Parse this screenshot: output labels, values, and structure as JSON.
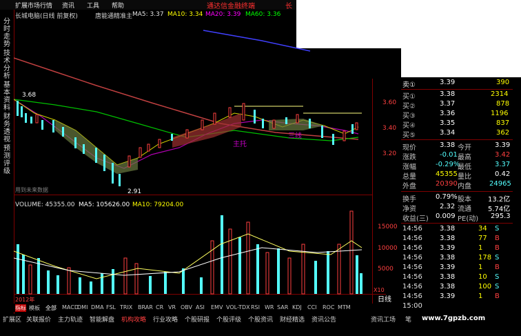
{
  "menubar": {
    "items": [
      "扩展市场行情",
      "资讯",
      "工具",
      "帮助"
    ]
  },
  "brand": "通达信金融终端",
  "brand_extra": "长",
  "sidebar": {
    "tabs": [
      "分时走势",
      "技术分析",
      "基本资料",
      "财务透视",
      "预测评级"
    ]
  },
  "title": {
    "stock": "长城电脑(日线 前复权)",
    "indicator": "唐能通精准主",
    "ma5_label": "MA5: 3.37",
    "ma10_label": "MA10: 3.34",
    "ma20_label": "MA20: 3.39",
    "ma60_label": "MA60: 3.36"
  },
  "chart": {
    "price_high_label": "3.68",
    "price_low_label": "2.91",
    "annotation1": "主托",
    "annotation2": "三线",
    "annotation3": "用到未来数据",
    "axis_prices": [
      "3.60",
      "3.40",
      "3.20"
    ],
    "axis_volumes": [
      "15000",
      "10000",
      "5000"
    ],
    "axis_unit": "X10",
    "year": "2012年"
  },
  "volume": {
    "vol": "VOLUME: 45355.00",
    "ma5": "MA5: 105626.00",
    "ma10": "MA10: 79204.00"
  },
  "quote": {
    "sell": [
      {
        "label": "卖①",
        "price": "3.39",
        "qty": "390"
      }
    ],
    "buy": [
      {
        "label": "买①",
        "price": "3.38",
        "qty": "2314"
      },
      {
        "label": "买②",
        "price": "3.37",
        "qty": "878"
      },
      {
        "label": "买③",
        "price": "3.36",
        "qty": "1196"
      },
      {
        "label": "买④",
        "price": "3.35",
        "qty": "837"
      },
      {
        "label": "买⑤",
        "price": "3.34",
        "qty": "362"
      }
    ],
    "stats": [
      {
        "l1": "现价",
        "v1": "3.38",
        "l2": "今开",
        "v2": "3.39"
      },
      {
        "l1": "涨跌",
        "v1": "-0.01",
        "l2": "最高",
        "v2": "3.42"
      },
      {
        "l1": "涨幅",
        "v1": "-0.29%",
        "l2": "最低",
        "v2": "3.37"
      },
      {
        "l1": "总量",
        "v1": "45355",
        "l2": "量比",
        "v2": "0.42"
      },
      {
        "l1": "外盘",
        "v1": "20390",
        "l2": "内盘",
        "v2": "24965"
      }
    ],
    "fin": [
      {
        "l1": "换手",
        "v1": "0.79%",
        "l2": "股本",
        "v2": "13.2亿"
      },
      {
        "l1": "净资",
        "v1": "2.32",
        "l2": "流通",
        "v2": "5.74亿"
      },
      {
        "l1": "收益(三)",
        "v1": "0.009",
        "l2": "PE(动)",
        "v2": "295.3"
      }
    ],
    "ticks": [
      {
        "time": "14:56",
        "price": "3.38",
        "vol": "34",
        "side": "S"
      },
      {
        "time": "14:56",
        "price": "3.38",
        "vol": "77",
        "side": "B"
      },
      {
        "time": "14:56",
        "price": "3.39",
        "vol": "1",
        "side": "B"
      },
      {
        "time": "14:56",
        "price": "3.38",
        "vol": "178",
        "side": "S"
      },
      {
        "time": "14:56",
        "price": "3.39",
        "vol": "1",
        "side": "B"
      },
      {
        "time": "14:56",
        "price": "3.38",
        "vol": "10",
        "side": "S"
      },
      {
        "time": "14:56",
        "price": "3.38",
        "vol": "100",
        "side": "S"
      },
      {
        "time": "14:56",
        "price": "3.39",
        "vol": "1",
        "side": "B"
      },
      {
        "time": "15:00",
        "price": "",
        "vol": "",
        "side": ""
      }
    ]
  },
  "period": "日线",
  "indicator_tabs": [
    "指标",
    "模板",
    "全部",
    "MACD",
    "DMI",
    "DMA",
    "FSL",
    "TRIX",
    "BRAR",
    "CR",
    "VR",
    "OBV",
    "ASI",
    "EMV",
    "VOL-TDX",
    "RSI",
    "WR",
    "SAR",
    "KDJ",
    "CCI",
    "ROC",
    "MTM"
  ],
  "bottom_tabs": [
    "扩展区",
    "关联报价",
    "主力轨迹",
    "智能解盘",
    "机构攻略",
    "行业攻略",
    "个股研报",
    "个股评级",
    "个股资讯",
    "财经精选",
    "资讯公告"
  ],
  "bottom_right": [
    "资讯工场",
    "笔"
  ],
  "watermark": "www.7gpzb.com"
}
